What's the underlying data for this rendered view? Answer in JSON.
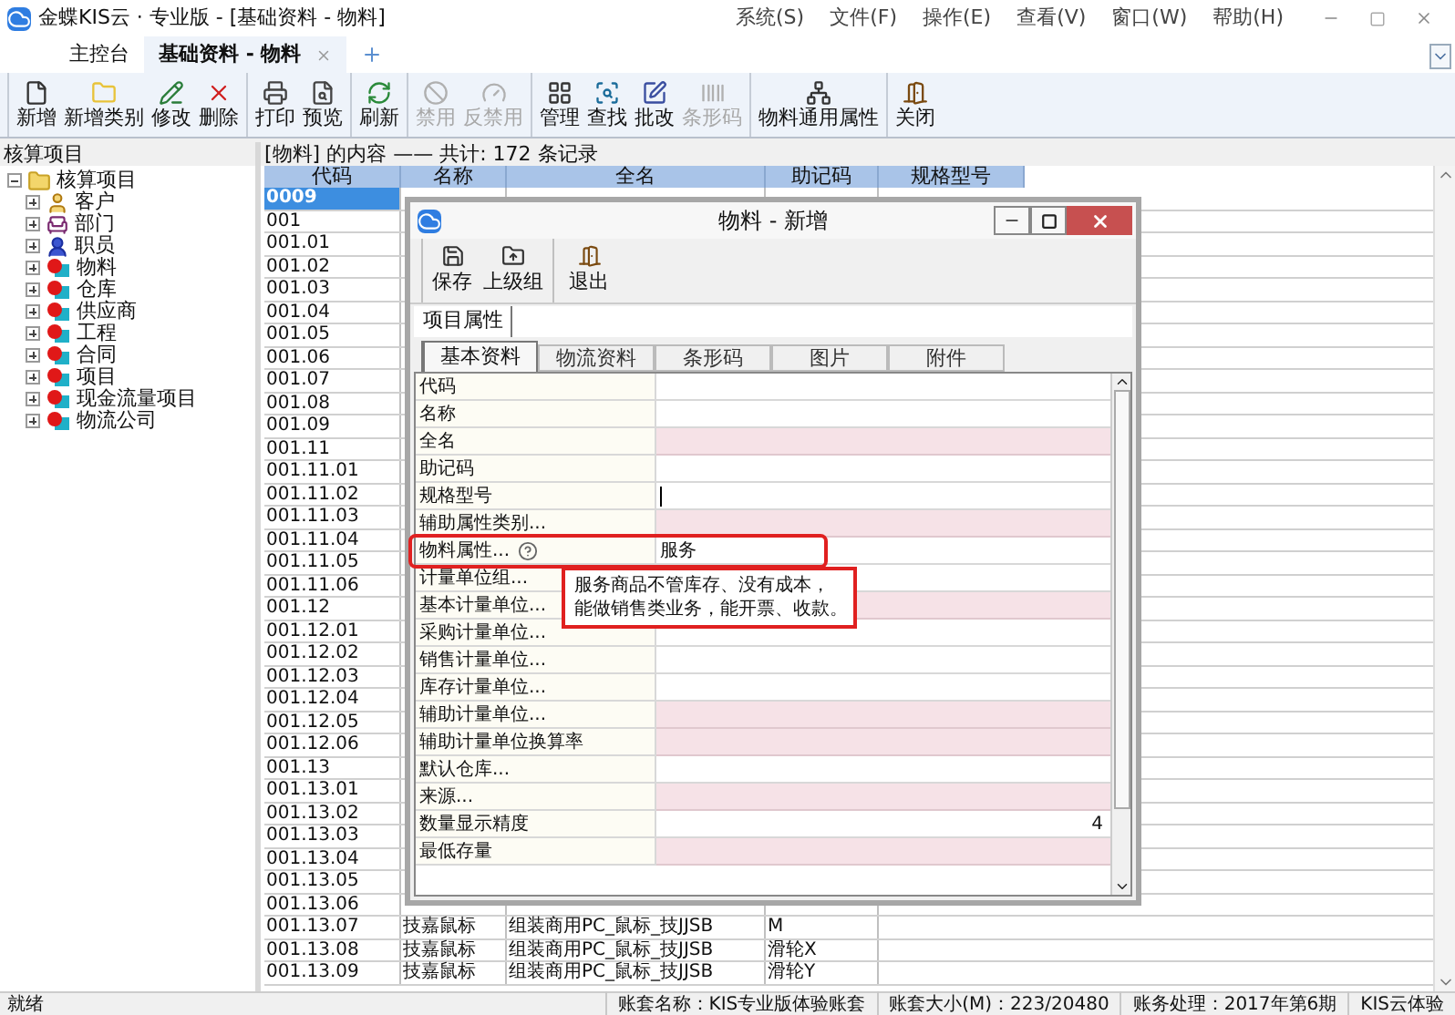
{
  "window": {
    "title": "金蝶KIS云 · 专业版 - [基础资料 - 物料]",
    "menu": [
      "系统(S)",
      "文件(F)",
      "操作(E)",
      "查看(V)",
      "窗口(W)",
      "帮助(H)"
    ]
  },
  "tabs": [
    {
      "label": "主控台",
      "selected": false,
      "closable": false
    },
    {
      "label": "基础资料 - 物料",
      "selected": true,
      "closable": true
    }
  ],
  "toolbar": {
    "groups": [
      [
        {
          "label": "新增",
          "disabled": false
        },
        {
          "label": "新增类别",
          "disabled": false
        },
        {
          "label": "修改",
          "disabled": false
        },
        {
          "label": "删除",
          "disabled": false
        }
      ],
      [
        {
          "label": "打印",
          "disabled": false
        },
        {
          "label": "预览",
          "disabled": false
        }
      ],
      [
        {
          "label": "刷新",
          "disabled": false
        }
      ],
      [
        {
          "label": "禁用",
          "disabled": true
        },
        {
          "label": "反禁用",
          "disabled": true
        }
      ],
      [
        {
          "label": "管理",
          "disabled": false
        },
        {
          "label": "查找",
          "disabled": false
        },
        {
          "label": "批改",
          "disabled": false
        },
        {
          "label": "条形码",
          "disabled": true
        }
      ],
      [
        {
          "label": "物料通用属性",
          "disabled": false
        }
      ],
      [
        {
          "label": "关闭",
          "disabled": false
        }
      ]
    ]
  },
  "sidebar": {
    "title": "核算项目",
    "tree": [
      {
        "label": "核算项目",
        "kind": "folder",
        "expanded": true,
        "children": [
          {
            "label": "客户",
            "kind": "customer",
            "expanded": false
          },
          {
            "label": "部门",
            "kind": "department",
            "expanded": false
          },
          {
            "label": "职员",
            "kind": "employee",
            "expanded": false
          },
          {
            "label": "物料",
            "kind": "item",
            "expanded": false
          },
          {
            "label": "仓库",
            "kind": "item",
            "expanded": false
          },
          {
            "label": "供应商",
            "kind": "item",
            "expanded": false
          },
          {
            "label": "工程",
            "kind": "item",
            "expanded": false
          },
          {
            "label": "合同",
            "kind": "item",
            "expanded": false
          },
          {
            "label": "项目",
            "kind": "item",
            "expanded": false
          },
          {
            "label": "现金流量项目",
            "kind": "item",
            "expanded": false
          },
          {
            "label": "物流公司",
            "kind": "item",
            "expanded": false
          }
        ]
      }
    ]
  },
  "table": {
    "caption": "[物料] 的内容 —— 共计: 172 条记录",
    "columns": [
      "代码",
      "名称",
      "全名",
      "助记码",
      "规格型号"
    ],
    "rows": [
      {
        "code": "0009",
        "selected": true
      },
      {
        "code": "001",
        "selected": false
      },
      {
        "code": "001.01",
        "selected": false
      },
      {
        "code": "001.02",
        "selected": false
      },
      {
        "code": "001.03",
        "selected": false
      },
      {
        "code": "001.04",
        "selected": false
      },
      {
        "code": "001.05",
        "selected": false
      },
      {
        "code": "001.06",
        "selected": false
      },
      {
        "code": "001.07",
        "selected": false
      },
      {
        "code": "001.08",
        "selected": false
      },
      {
        "code": "001.09",
        "selected": false
      },
      {
        "code": "001.11",
        "selected": false
      },
      {
        "code": "001.11.01",
        "selected": false
      },
      {
        "code": "001.11.02",
        "selected": false
      },
      {
        "code": "001.11.03",
        "selected": false
      },
      {
        "code": "001.11.04",
        "selected": false
      },
      {
        "code": "001.11.05",
        "selected": false
      },
      {
        "code": "001.11.06",
        "selected": false
      },
      {
        "code": "001.12",
        "selected": false
      },
      {
        "code": "001.12.01",
        "selected": false
      },
      {
        "code": "001.12.02",
        "selected": false
      },
      {
        "code": "001.12.03",
        "selected": false
      },
      {
        "code": "001.12.04",
        "selected": false
      },
      {
        "code": "001.12.05",
        "selected": false
      },
      {
        "code": "001.12.06",
        "selected": false
      },
      {
        "code": "001.13",
        "selected": false
      },
      {
        "code": "001.13.01",
        "selected": false
      },
      {
        "code": "001.13.02",
        "selected": false
      },
      {
        "code": "001.13.03",
        "selected": false
      },
      {
        "code": "001.13.04",
        "selected": false
      },
      {
        "code": "001.13.05",
        "selected": false
      },
      {
        "code": "001.13.06",
        "selected": false
      },
      {
        "code": "001.13.07",
        "name": "技嘉鼠标",
        "full_name": "组装商用PC_鼠标_技JJSB",
        "mnemonic": "M",
        "selected": false
      },
      {
        "code": "001.13.08",
        "name": "技嘉鼠标",
        "full_name": "组装商用PC_鼠标_技JJSB",
        "mnemonic": "滑轮X",
        "selected": false
      },
      {
        "code": "001.13.09",
        "name": "技嘉鼠标",
        "full_name": "组装商用PC_鼠标_技JJSB",
        "mnemonic": "滑轮Y",
        "selected": false
      }
    ]
  },
  "dialog": {
    "title": "物料 - 新增",
    "toolbar": [
      "保存",
      "上级组",
      "退出"
    ],
    "section": "项目属性",
    "tabs": [
      {
        "label": "基本资料",
        "selected": true
      },
      {
        "label": "物流资料",
        "selected": false
      },
      {
        "label": "条形码",
        "selected": false
      },
      {
        "label": "图片",
        "selected": false
      },
      {
        "label": "附件",
        "selected": false
      }
    ],
    "properties": [
      {
        "label": "代码",
        "required": false,
        "highlighted": false
      },
      {
        "label": "名称",
        "required": false,
        "highlighted": false
      },
      {
        "label": "全名",
        "required": true,
        "highlighted": false
      },
      {
        "label": "助记码",
        "required": false,
        "highlighted": false
      },
      {
        "label": "规格型号",
        "required": false,
        "highlighted": false,
        "focused": true
      },
      {
        "label": "辅助属性类别...",
        "required": true,
        "highlighted": false
      },
      {
        "label": "物料属性...",
        "value": "服务",
        "required": false,
        "highlighted": true,
        "help": true
      },
      {
        "label": "计量单位组...",
        "required": false,
        "highlighted": false
      },
      {
        "label": "基本计量单位...",
        "required": true,
        "highlighted": false
      },
      {
        "label": "采购计量单位...",
        "required": false,
        "highlighted": false
      },
      {
        "label": "销售计量单位...",
        "required": false,
        "highlighted": false
      },
      {
        "label": "库存计量单位...",
        "required": false,
        "highlighted": false
      },
      {
        "label": "辅助计量单位...",
        "required": true,
        "highlighted": false
      },
      {
        "label": "辅助计量单位换算率",
        "required": true,
        "highlighted": false
      },
      {
        "label": "默认仓库...",
        "required": false,
        "highlighted": false
      },
      {
        "label": "来源...",
        "required": true,
        "highlighted": false
      },
      {
        "label": "数量显示精度",
        "value": "4",
        "required": false,
        "highlighted": false
      },
      {
        "label": "最低存量",
        "required": true,
        "highlighted": false
      }
    ],
    "callout": [
      "服务商品不管库存、没有成本，",
      "能做销售类业务，能开票、收款。"
    ]
  },
  "status_bar": [
    "就绪",
    "账套名称：KIS专业版体验账套",
    "账套大小(M)：223/20480",
    "账务处理：2017年第6期",
    "KIS云体验"
  ]
}
